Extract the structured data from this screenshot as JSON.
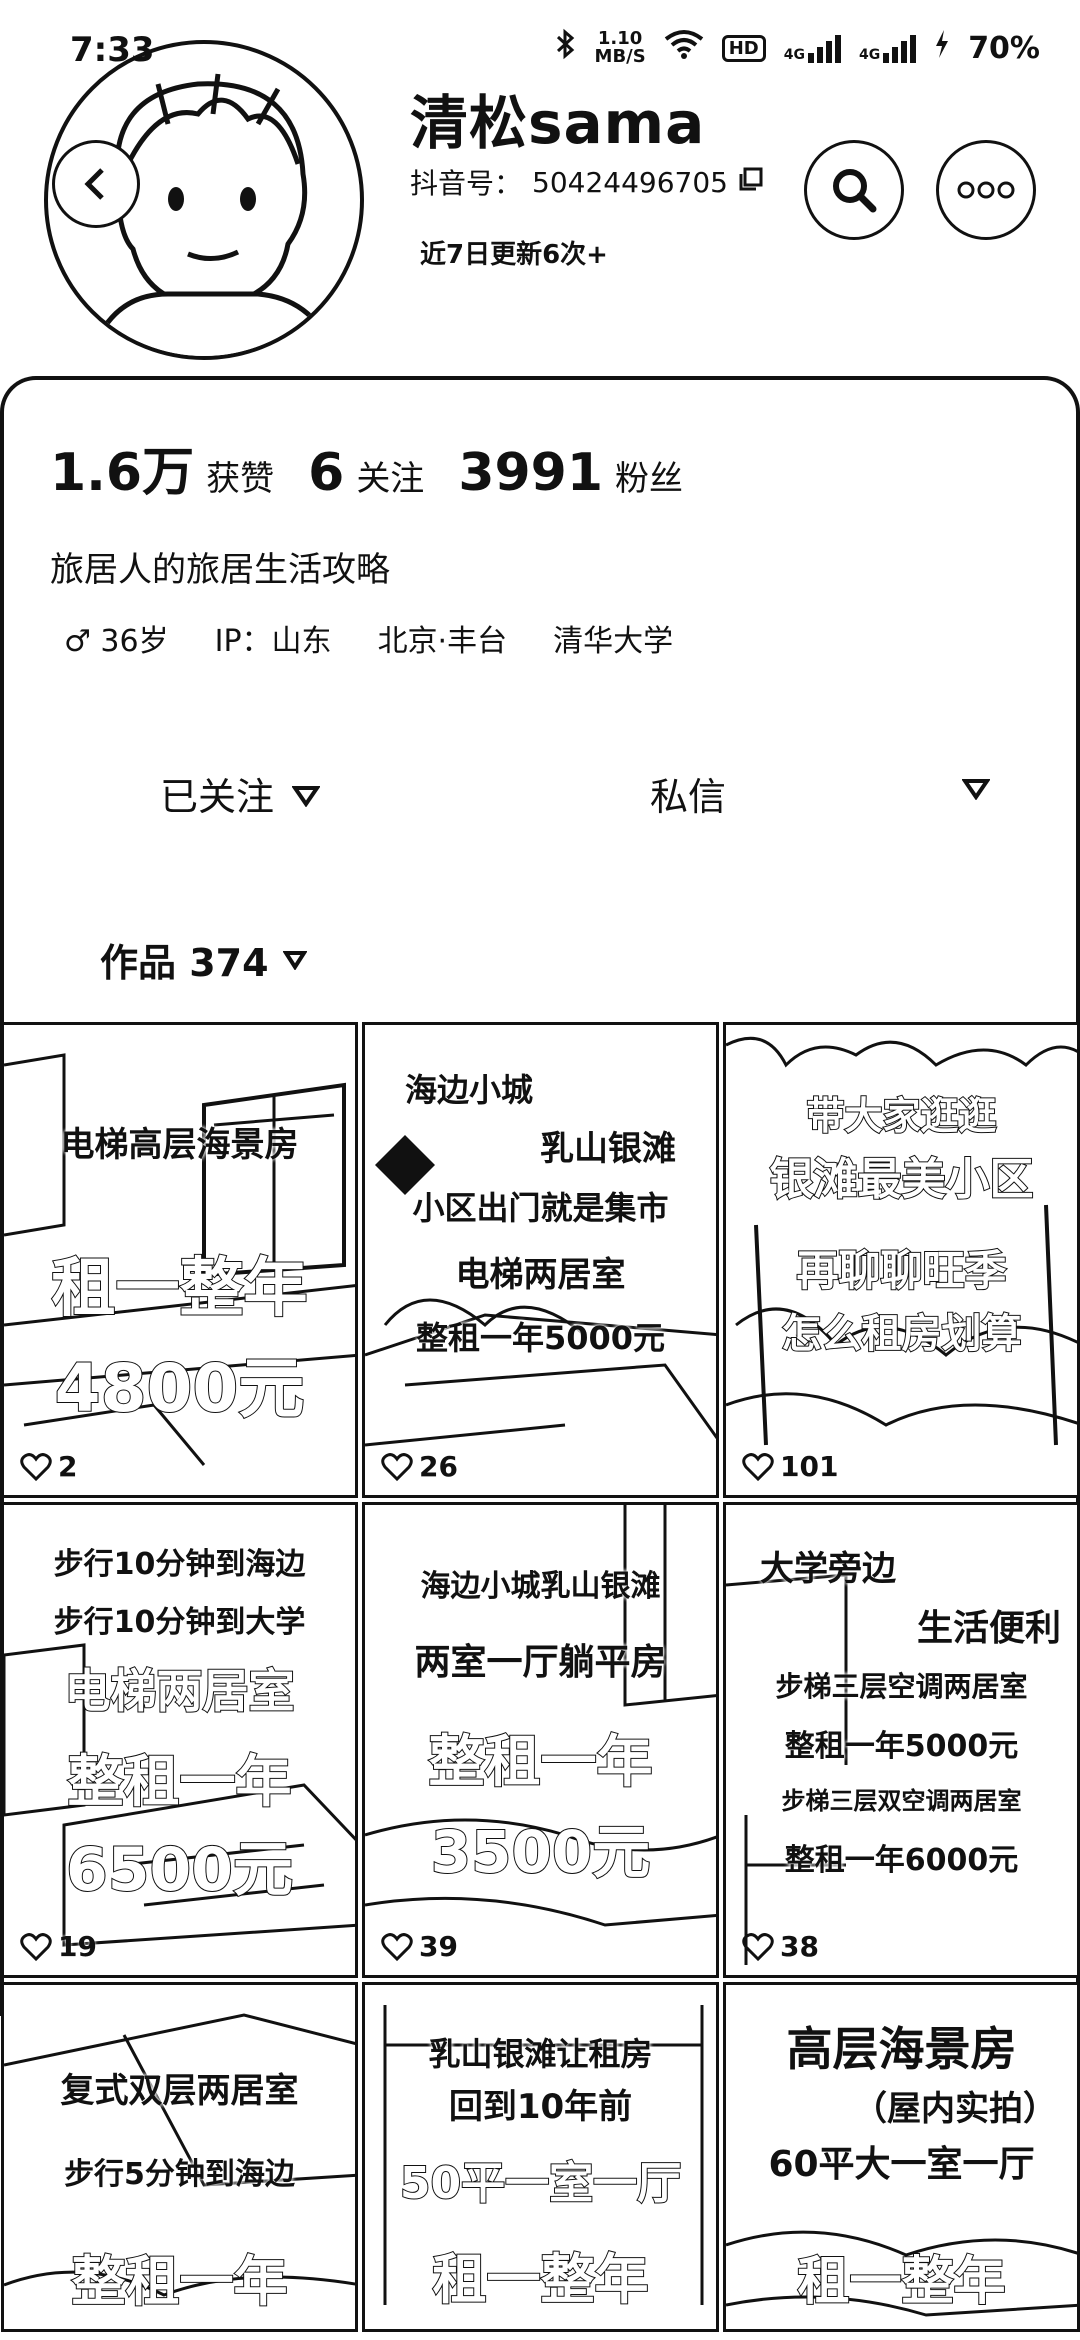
{
  "status_bar": {
    "time": "7:33",
    "net_speed_value": "1.10",
    "net_speed_unit": "MB/S",
    "hd_badge": "HD",
    "signal_1": "4G",
    "signal_2": "4G",
    "battery": "70%"
  },
  "profile": {
    "name": "清松sama",
    "account_label": "抖音号：",
    "account_id": "50424496705",
    "update_note": "近7日更新6次+"
  },
  "stats": [
    {
      "value": "1.6万",
      "label": "获赞"
    },
    {
      "value": "6",
      "label": "关注"
    },
    {
      "value": "3991",
      "label": "粉丝"
    }
  ],
  "bio": "旅居人的旅居生活攻略",
  "tags": {
    "gender_age": "♂ 36岁",
    "ip": "IP：山东",
    "location": "北京·丰台",
    "school": "清华大学"
  },
  "actions": {
    "follow_label": "已关注",
    "dm_label": "私信"
  },
  "works_tab": {
    "label": "作品 374"
  },
  "videos": [
    {
      "lines": [
        "电梯高层海景房",
        "租一整年",
        "4800元"
      ],
      "likes": "2"
    },
    {
      "lines": [
        "海边小城",
        "乳山银滩",
        "小区出门就是集市",
        "电梯两居室",
        "整租一年5000元"
      ],
      "likes": "26"
    },
    {
      "lines": [
        "带大家逛逛",
        "银滩最美小区",
        "再聊聊旺季",
        "怎么租房划算"
      ],
      "likes": "101"
    },
    {
      "lines": [
        "步行10分钟到海边",
        "步行10分钟到大学",
        "电梯两居室",
        "整租一年",
        "6500元"
      ],
      "likes": "19"
    },
    {
      "lines": [
        "海边小城乳山银滩",
        "两室一厅躺平房",
        "整租一年",
        "3500元"
      ],
      "likes": "39"
    },
    {
      "lines": [
        "大学旁边",
        "生活便利",
        "步梯三层空调两居室",
        "整租一年5000元",
        "步梯三层双空调两居室",
        "整租一年6000元"
      ],
      "likes": "38"
    },
    {
      "lines": [
        "复式双层两居室",
        "步行5分钟到海边",
        "整租一年"
      ],
      "likes": ""
    },
    {
      "lines": [
        "乳山银滩让租房",
        "回到10年前",
        "50平一室一厅",
        "租一整年"
      ],
      "likes": ""
    },
    {
      "lines": [
        "高层海景房",
        "（屋内实拍）",
        "60平大一室一厅",
        "租一整年"
      ],
      "likes": ""
    }
  ],
  "colors": {
    "text": "#111111",
    "background": "#ffffff"
  }
}
